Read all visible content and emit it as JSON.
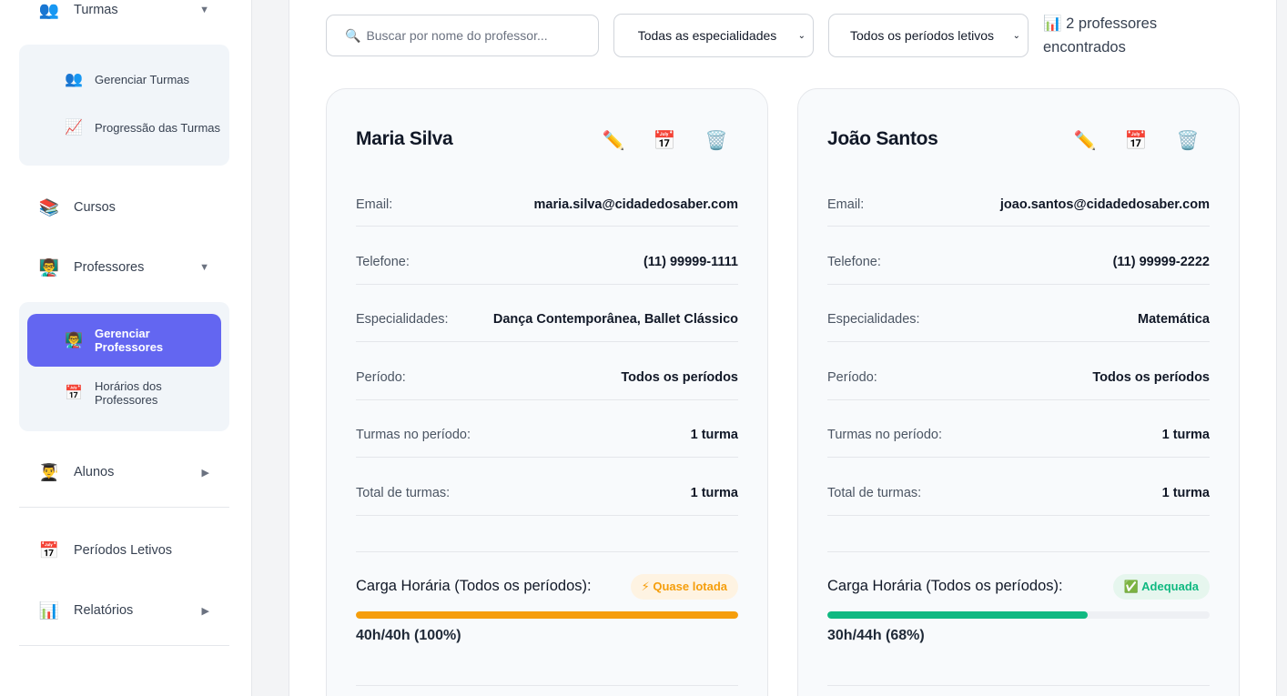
{
  "sidebar": {
    "turmas": {
      "label": "Turmas",
      "icon": "people-icon",
      "arrow": "▼"
    },
    "turmas_sub": [
      {
        "label": "Gerenciar Turmas",
        "icon": "people-icon"
      },
      {
        "label": "Progressão das Turmas",
        "icon": "chart-up-icon"
      }
    ],
    "cursos": {
      "label": "Cursos",
      "icon": "books-icon"
    },
    "professores": {
      "label": "Professores",
      "icon": "teacher-icon",
      "arrow": "▼"
    },
    "professores_sub": [
      {
        "label": "Gerenciar Professores",
        "icon": "teacher-icon",
        "active": true
      },
      {
        "label": "Horários dos Professores",
        "icon": "calendar-icon"
      }
    ],
    "alunos": {
      "label": "Alunos",
      "icon": "student-icon",
      "arrow": "▶"
    },
    "periodos": {
      "label": "Períodos Letivos",
      "icon": "calendar-icon"
    },
    "relatorios": {
      "label": "Relatórios",
      "icon": "bar-chart-icon",
      "arrow": "▶"
    }
  },
  "filters": {
    "search_placeholder": "Buscar por nome do professor...",
    "specialty_selected": "Todas as especialidades",
    "period_selected": "Todos os períodos letivos",
    "found_text": "📊 2 professores encontrados"
  },
  "labels": {
    "email": "Email:",
    "phone": "Telefone:",
    "specialties": "Especialidades:",
    "period": "Período:",
    "classes_period": "Turmas no período:",
    "classes_total": "Total de turmas:",
    "load": "Carga Horária (Todos os períodos):"
  },
  "teachers": [
    {
      "name": "Maria Silva",
      "email": "maria.silva@cidadedosaber.com",
      "phone": "(11) 99999-1111",
      "specialties": "Dança Contemporânea, Ballet Clássico",
      "period": "Todos os períodos",
      "classes_period": "1 turma",
      "classes_total": "1 turma",
      "badge": "⚡ Quase lotada",
      "badge_bg": "#fef3e2",
      "badge_color": "#f59e0b",
      "load_text": "40h/40h (100%)",
      "load_fraction": 1.0,
      "bar_color": "#f59e0b"
    },
    {
      "name": "João Santos",
      "email": "joao.santos@cidadedosaber.com",
      "phone": "(11) 99999-2222",
      "specialties": "Matemática",
      "period": "Todos os períodos",
      "classes_period": "1 turma",
      "classes_total": "1 turma",
      "badge": "✅ Adequada",
      "badge_bg": "#e6f6ee",
      "badge_color": "#10b981",
      "load_text": "30h/44h (68%)",
      "load_fraction": 0.68,
      "bar_color": "#10b981"
    }
  ]
}
